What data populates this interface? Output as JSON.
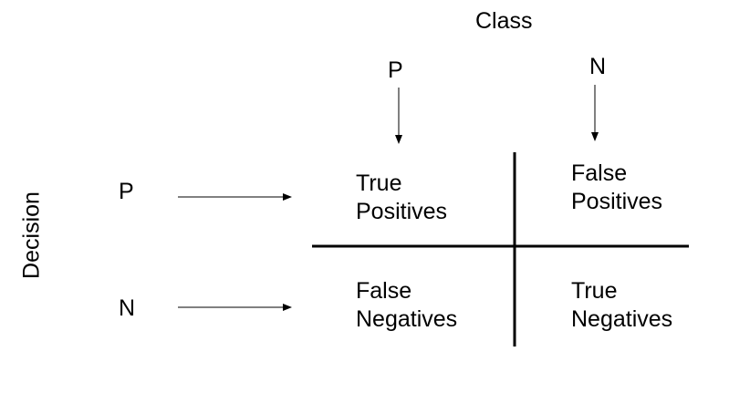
{
  "column_axis": {
    "title": "Class",
    "labels": [
      "P",
      "N"
    ]
  },
  "row_axis": {
    "title": "Decision",
    "labels": [
      "P",
      "N"
    ]
  },
  "matrix": {
    "cells": [
      [
        "True",
        "Positives"
      ],
      [
        "False",
        "Positives"
      ],
      [
        "False",
        "Negatives"
      ],
      [
        "True",
        "Negatives"
      ]
    ]
  },
  "colors": {
    "ink": "#000000",
    "background": "#ffffff"
  }
}
